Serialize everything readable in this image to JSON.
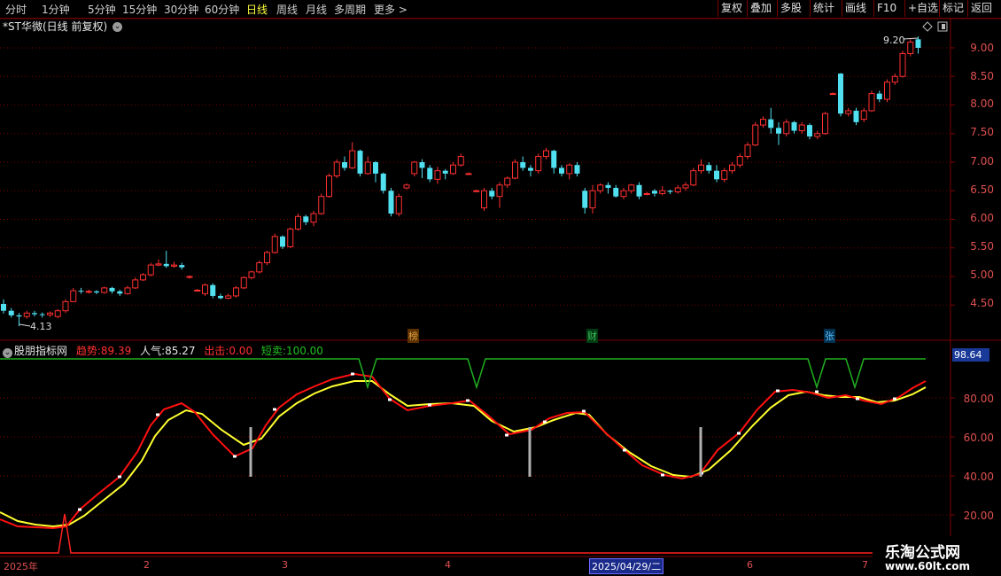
{
  "toolbar": {
    "periods": [
      "分时",
      "1分钟",
      "5分钟",
      "15分钟",
      "30分钟",
      "60分钟",
      "日线",
      "周线",
      "月线",
      "多周期",
      "更多"
    ],
    "active_period": "日线",
    "right_buttons": [
      "复权",
      "叠加",
      "多股",
      "统计",
      "画线",
      "F10",
      "+自选",
      "返回"
    ]
  },
  "stock": {
    "title": "*ST华微(日线 前复权)",
    "high_label": "9.20",
    "low_label": "4.13"
  },
  "price_axis": [
    "9.00",
    "8.50",
    "8.00",
    "7.50",
    "7.00",
    "6.50",
    "6.00",
    "5.50",
    "5.00",
    "4.50"
  ],
  "indicator": {
    "name": "股朋指标网",
    "trend_label": "趋势:",
    "trend_value": "89.39",
    "popularity_label": "人气:",
    "popularity_value": "85.27",
    "out_label": "出击:",
    "out_value": "0.00",
    "short_sell_label": "短卖:",
    "short_sell_value": "100.00",
    "current_value_box": "98.64",
    "axis": [
      "80.00",
      "60.00",
      "40.00",
      "20.00"
    ]
  },
  "tags": [
    {
      "text": "榜",
      "color": "#e0a040",
      "bg": "#5a3000"
    },
    {
      "text": "财",
      "color": "#40c060",
      "bg": "#003a10"
    },
    {
      "text": "张",
      "color": "#60c0ff",
      "bg": "#003050"
    }
  ],
  "date_axis": {
    "labels": [
      "2025年",
      "2",
      "3",
      "4",
      "6",
      "7"
    ],
    "cursor_date": "2025/04/29/二"
  },
  "watermark": {
    "line1": "乐淘公式网",
    "line2": "www.60lt.com"
  },
  "colors": {
    "up": "#ff3030",
    "down": "#50e0f0",
    "trend_line": "#ff1010",
    "popularity_line": "#ffff30",
    "short_sell_line": "#20b020",
    "grid": "#7a0000"
  },
  "chart_data": {
    "type": "candlestick",
    "ylim": [
      4.2,
      9.35
    ],
    "candles": [
      [
        4.52,
        4.4,
        4.6,
        4.35
      ],
      [
        4.4,
        4.32,
        4.45,
        4.28
      ],
      [
        4.32,
        4.3,
        4.36,
        4.13
      ],
      [
        4.3,
        4.36,
        4.4,
        4.26
      ],
      [
        4.36,
        4.34,
        4.4,
        4.3
      ],
      [
        4.34,
        4.33,
        4.37,
        4.28
      ],
      [
        4.33,
        4.36,
        4.39,
        4.29
      ],
      [
        4.3,
        4.4,
        4.43,
        4.27
      ],
      [
        4.4,
        4.56,
        4.6,
        4.36
      ],
      [
        4.56,
        4.75,
        4.8,
        4.55
      ],
      [
        4.75,
        4.74,
        4.8,
        4.7
      ],
      [
        4.74,
        4.74,
        4.77,
        4.7
      ],
      [
        4.74,
        4.72,
        4.76,
        4.69
      ],
      [
        4.72,
        4.8,
        4.82,
        4.7
      ],
      [
        4.8,
        4.74,
        4.82,
        4.7
      ],
      [
        4.74,
        4.7,
        4.77,
        4.66
      ],
      [
        4.7,
        4.8,
        4.84,
        4.68
      ],
      [
        4.8,
        4.94,
        4.98,
        4.78
      ],
      [
        4.94,
        5.03,
        5.06,
        4.92
      ],
      [
        5.03,
        5.2,
        5.24,
        5.0
      ],
      [
        5.2,
        5.22,
        5.3,
        5.18
      ],
      [
        5.22,
        5.18,
        5.45,
        5.15
      ],
      [
        5.18,
        5.2,
        5.26,
        5.15
      ],
      [
        5.2,
        5.16,
        5.24,
        5.12
      ],
      [
        5.0,
        5.0,
        5.02,
        4.96
      ],
      [
        4.76,
        4.76,
        4.78,
        4.74
      ],
      [
        4.7,
        4.85,
        4.88,
        4.66
      ],
      [
        4.85,
        4.66,
        4.88,
        4.62
      ],
      [
        4.66,
        4.62,
        4.7,
        4.6
      ],
      [
        4.62,
        4.66,
        4.7,
        4.6
      ],
      [
        4.66,
        4.8,
        4.83,
        4.63
      ],
      [
        4.8,
        4.98,
        5.0,
        4.78
      ],
      [
        4.98,
        5.08,
        5.1,
        4.95
      ],
      [
        5.08,
        5.24,
        5.28,
        5.05
      ],
      [
        5.24,
        5.42,
        5.45,
        5.2
      ],
      [
        5.42,
        5.7,
        5.75,
        5.4
      ],
      [
        5.7,
        5.52,
        5.72,
        5.48
      ],
      [
        5.52,
        5.83,
        5.86,
        5.5
      ],
      [
        5.83,
        6.05,
        6.1,
        5.8
      ],
      [
        6.05,
        5.95,
        6.08,
        5.9
      ],
      [
        5.95,
        6.1,
        6.15,
        5.88
      ],
      [
        6.1,
        6.4,
        6.45,
        6.08
      ],
      [
        6.4,
        6.76,
        6.8,
        6.38
      ],
      [
        6.76,
        7.0,
        7.05,
        6.72
      ],
      [
        7.0,
        6.9,
        7.1,
        6.85
      ],
      [
        6.9,
        7.2,
        7.35,
        6.88
      ],
      [
        7.2,
        6.8,
        7.22,
        6.75
      ],
      [
        6.8,
        7.0,
        7.1,
        6.78
      ],
      [
        7.0,
        6.8,
        7.02,
        6.65
      ],
      [
        6.8,
        6.5,
        6.82,
        6.45
      ],
      [
        6.5,
        6.1,
        6.55,
        6.05
      ],
      [
        6.1,
        6.4,
        6.45,
        6.05
      ],
      [
        6.55,
        6.6,
        6.63,
        6.52
      ],
      [
        6.8,
        7.0,
        7.02,
        6.75
      ],
      [
        7.0,
        6.9,
        7.05,
        6.72
      ],
      [
        6.9,
        6.7,
        6.95,
        6.65
      ],
      [
        6.7,
        6.85,
        6.92,
        6.62
      ],
      [
        6.85,
        6.8,
        6.88,
        6.7
      ],
      [
        6.8,
        6.95,
        7.0,
        6.78
      ],
      [
        6.95,
        7.1,
        7.15,
        6.92
      ],
      [
        6.8,
        6.8,
        6.82,
        6.78
      ],
      [
        6.5,
        6.5,
        6.52,
        6.48
      ],
      [
        6.2,
        6.5,
        6.55,
        6.15
      ],
      [
        6.5,
        6.4,
        6.55,
        6.35
      ],
      [
        6.4,
        6.6,
        6.65,
        6.2
      ],
      [
        6.6,
        6.72,
        6.75,
        6.55
      ],
      [
        6.72,
        7.0,
        7.05,
        6.7
      ],
      [
        7.0,
        6.9,
        7.1,
        6.85
      ],
      [
        6.9,
        6.85,
        6.95,
        6.75
      ],
      [
        6.85,
        7.1,
        7.15,
        6.8
      ],
      [
        7.1,
        7.2,
        7.25,
        7.05
      ],
      [
        7.2,
        6.9,
        7.22,
        6.8
      ],
      [
        6.9,
        6.8,
        6.95,
        6.75
      ],
      [
        6.8,
        6.95,
        6.98,
        6.7
      ],
      [
        6.95,
        6.8,
        7.0,
        6.75
      ],
      [
        6.5,
        6.2,
        6.55,
        6.1
      ],
      [
        6.2,
        6.5,
        6.6,
        6.1
      ],
      [
        6.5,
        6.6,
        6.63,
        6.45
      ],
      [
        6.6,
        6.55,
        6.65,
        6.45
      ],
      [
        6.55,
        6.4,
        6.6,
        6.38
      ],
      [
        6.4,
        6.5,
        6.55,
        6.35
      ],
      [
        6.5,
        6.6,
        6.62,
        6.45
      ],
      [
        6.6,
        6.4,
        6.65,
        6.35
      ],
      [
        6.45,
        6.45,
        6.48,
        6.42
      ],
      [
        6.5,
        6.45,
        6.53,
        6.4
      ],
      [
        6.45,
        6.5,
        6.58,
        6.42
      ],
      [
        6.5,
        6.48,
        6.52,
        6.44
      ],
      [
        6.48,
        6.55,
        6.6,
        6.45
      ],
      [
        6.55,
        6.6,
        6.65,
        6.5
      ],
      [
        6.6,
        6.85,
        6.9,
        6.58
      ],
      [
        6.85,
        6.95,
        7.05,
        6.8
      ],
      [
        6.95,
        6.85,
        7.0,
        6.8
      ],
      [
        6.85,
        6.7,
        6.95,
        6.65
      ],
      [
        6.7,
        6.85,
        6.9,
        6.65
      ],
      [
        6.85,
        6.95,
        7.0,
        6.8
      ],
      [
        6.95,
        7.1,
        7.15,
        6.9
      ],
      [
        7.1,
        7.3,
        7.35,
        7.05
      ],
      [
        7.3,
        7.65,
        7.7,
        7.28
      ],
      [
        7.65,
        7.75,
        7.8,
        7.6
      ],
      [
        7.75,
        7.6,
        7.95,
        7.5
      ],
      [
        7.6,
        7.5,
        7.7,
        7.3
      ],
      [
        7.5,
        7.7,
        7.75,
        7.45
      ],
      [
        7.7,
        7.55,
        7.72,
        7.5
      ],
      [
        7.55,
        7.65,
        7.7,
        7.5
      ],
      [
        7.65,
        7.45,
        7.68,
        7.4
      ],
      [
        7.45,
        7.5,
        7.55,
        7.4
      ],
      [
        7.5,
        7.85,
        7.88,
        7.48
      ],
      [
        8.2,
        8.2,
        8.22,
        8.18
      ],
      [
        8.55,
        7.85,
        8.56,
        7.8
      ],
      [
        7.85,
        7.9,
        7.95,
        7.8
      ],
      [
        7.9,
        7.7,
        7.95,
        7.65
      ],
      [
        7.75,
        7.9,
        7.95,
        7.7
      ],
      [
        7.9,
        8.2,
        8.25,
        7.88
      ],
      [
        8.2,
        8.1,
        8.25,
        8.05
      ],
      [
        8.1,
        8.4,
        8.45,
        8.05
      ],
      [
        8.4,
        8.5,
        8.55,
        8.35
      ],
      [
        8.5,
        8.9,
        8.95,
        8.48
      ],
      [
        8.9,
        9.1,
        9.15,
        8.85
      ],
      [
        9.15,
        9.0,
        9.2,
        8.9
      ]
    ]
  }
}
